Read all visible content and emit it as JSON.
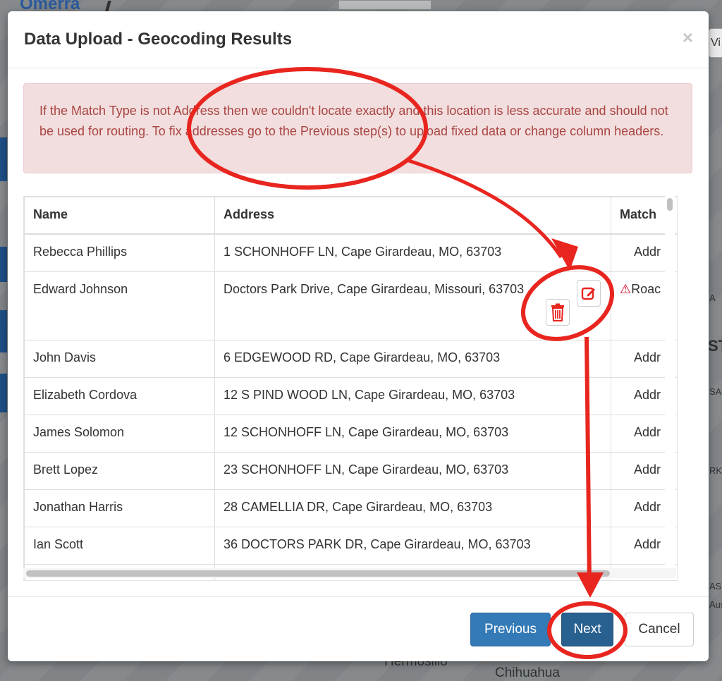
{
  "background_map": {
    "brand_text": "Omerra",
    "labels": [
      "Hermosillo",
      "Chihuahua",
      "Vi",
      "ST",
      "A",
      "SA",
      "RKL",
      "AS",
      "Aus"
    ]
  },
  "modal": {
    "title": "Data Upload - Geocoding Results",
    "close_symbol": "×",
    "alert_text": "If the Match Type is not Address then we couldn't locate exactly and this location is less accurate and should not be used for routing. To fix addresses go to the Previous step(s) to upload fixed data or change column headers.",
    "table": {
      "columns": [
        "Name",
        "Address",
        "Match"
      ],
      "rows": [
        {
          "name": "Rebecca Phillips",
          "address": "1 SCHONHOFF LN, Cape Girardeau, MO, 63703",
          "match": "Addr"
        },
        {
          "name": "Edward Johnson",
          "address": "Doctors Park Drive, Cape Girardeau, Missouri, 63703",
          "match": "Roac",
          "warning": true
        },
        {
          "name": "John Davis",
          "address": "6 EDGEWOOD RD, Cape Girardeau, MO, 63703",
          "match": "Addr"
        },
        {
          "name": "Elizabeth Cordova",
          "address": "12 S PIND WOOD LN, Cape Girardeau, MO, 63703",
          "match": "Addr"
        },
        {
          "name": "James Solomon",
          "address": "12 SCHONHOFF LN, Cape Girardeau, MO, 63703",
          "match": "Addr"
        },
        {
          "name": "Brett Lopez",
          "address": "23 SCHONHOFF LN, Cape Girardeau, MO, 63703",
          "match": "Addr"
        },
        {
          "name": "Jonathan Harris",
          "address": "28 CAMELLIA DR, Cape Girardeau, MO, 63703",
          "match": "Addr"
        },
        {
          "name": "Ian Scott",
          "address": "36 DOCTORS PARK DR, Cape Girardeau, MO, 63703",
          "match": "Addr"
        }
      ],
      "row_action_icons": [
        "edit-icon",
        "trash-icon"
      ]
    },
    "footer": {
      "previous_label": "Previous",
      "next_label": "Next",
      "cancel_label": "Cancel"
    }
  },
  "colors": {
    "annotation_red": "#e8251f",
    "primary_blue": "#337ab7",
    "alert_bg": "#f2dede",
    "alert_text": "#a94442"
  }
}
